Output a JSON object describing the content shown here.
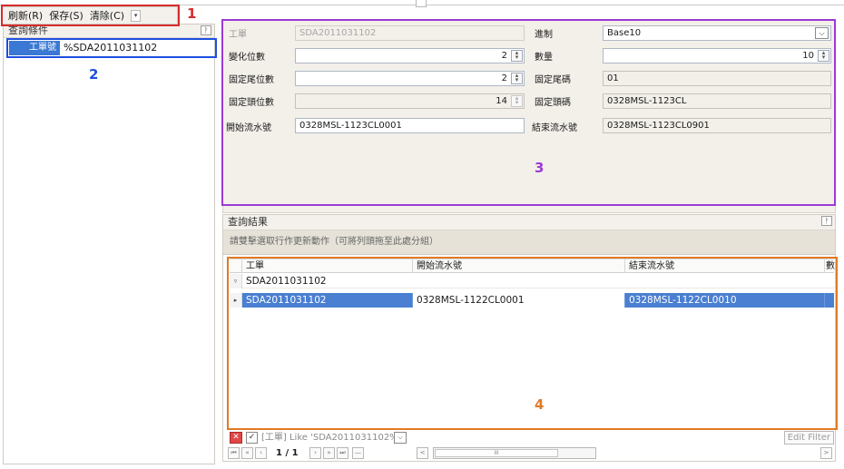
{
  "toolbar": {
    "refresh_label": "刷新(R)",
    "save_label": "保存(S)",
    "clear_label": "清除(C)",
    "dropdown_glyph": "▾"
  },
  "query_panel": {
    "title": "查詢條件",
    "pin_glyph": "ᚹ",
    "field_label": "工單號",
    "field_value": "%SDA2011031102"
  },
  "form": {
    "work_order_label": "工單",
    "work_order_value": "SDA2011031102",
    "base_label": "進制",
    "base_value": "Base10",
    "var_digits_label": "變化位數",
    "var_digits_value": "2",
    "quantity_label": "數量",
    "quantity_value": "10",
    "fixed_tail_digits_label": "固定尾位數",
    "fixed_tail_digits_value": "2",
    "fixed_tail_code_label": "固定尾碼",
    "fixed_tail_code_value": "01",
    "fixed_head_digits_label": "固定頭位數",
    "fixed_head_digits_value": "14",
    "fixed_head_code_label": "固定頭碼",
    "fixed_head_code_value": "0328MSL-1123CL",
    "start_serial_label": "開始流水號",
    "start_serial_value": "0328MSL-1123CL0001",
    "end_serial_label": "結束流水號",
    "end_serial_value": "0328MSL-1123CL0901"
  },
  "results": {
    "title": "查詢結果",
    "pin_glyph": "ᚹ",
    "group_hint": "請雙擊選取行作更新動作（可將列頭拖至此處分組）",
    "columns": [
      "工單",
      "開始流水號",
      "結束流水號",
      "數"
    ],
    "group_row": "SDA2011031102",
    "rows": [
      {
        "work_order": "SDA2011031102",
        "start": "0328MSL-1122CL0001",
        "end": "0328MSL-1122CL0010"
      }
    ],
    "filter_text": "[工單] Like 'SDA2011031102%'",
    "edit_filter_label": "Edit Filter",
    "page_text": "1 / 1",
    "scroll_thumb_glyph": "III"
  },
  "annotations": {
    "n1": "1",
    "n2": "2",
    "n3": "3",
    "n4": "4",
    "colors": {
      "n1": "#d62c2c",
      "n2": "#1e4fe0",
      "n3": "#9b3ad4",
      "n4": "#e07a26"
    }
  }
}
